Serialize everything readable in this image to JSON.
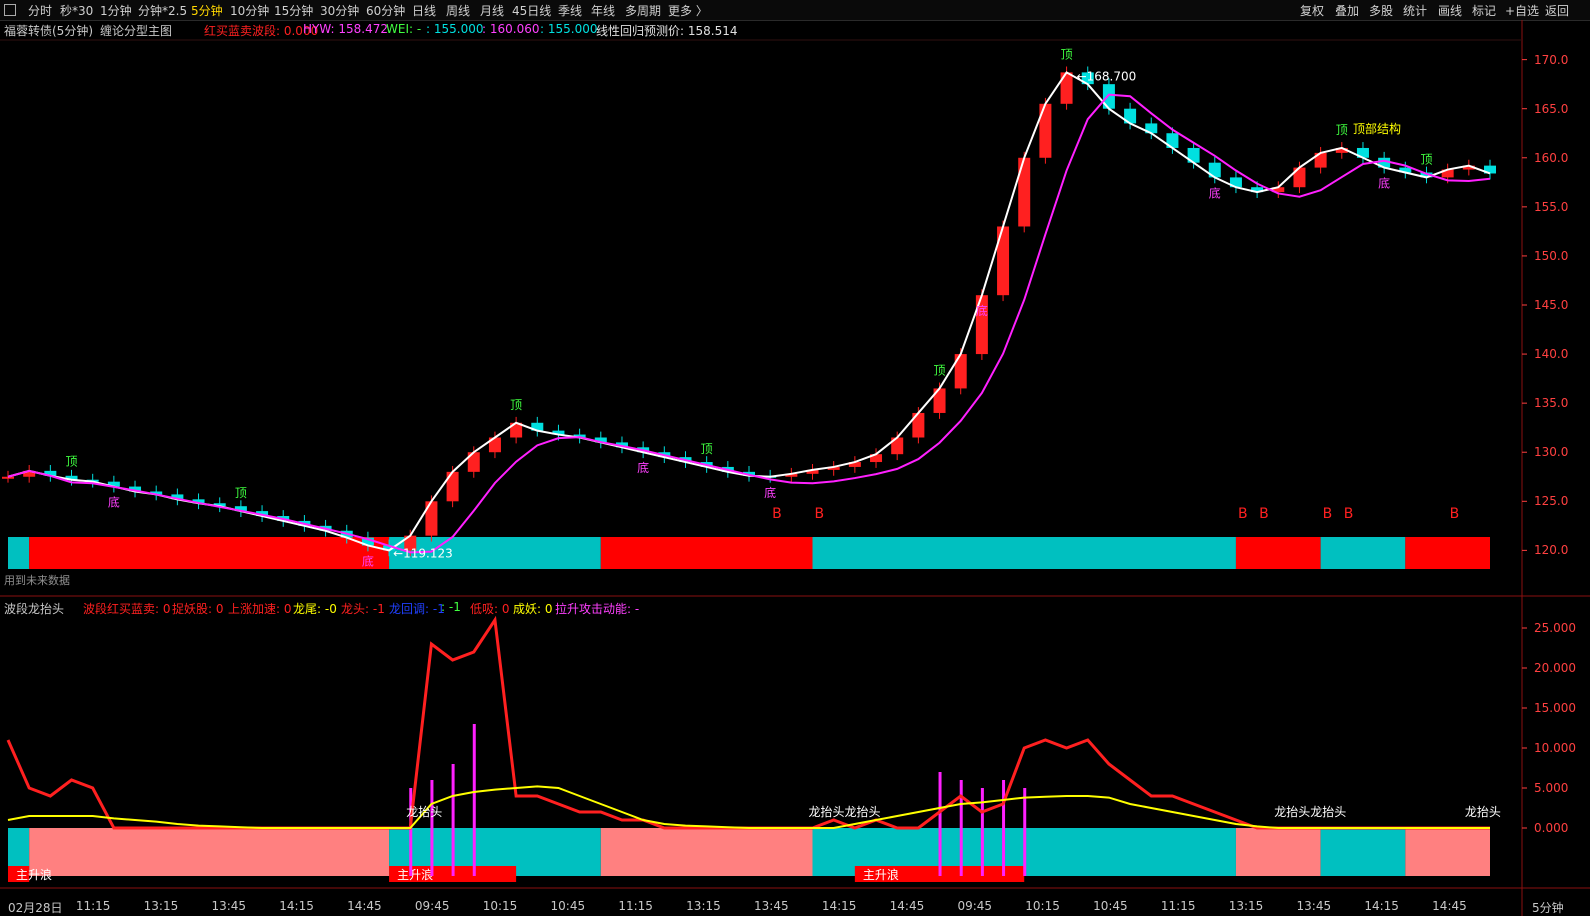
{
  "toolbar": {
    "periods": [
      "分时",
      "秒*30",
      "1分钟",
      "分钟*2.5",
      "5分钟",
      "10分钟",
      "15分钟",
      "30分钟",
      "60分钟",
      "日线",
      "周线",
      "月线",
      "45日线",
      "季线",
      "年线",
      "多周期",
      "更多 〉"
    ],
    "active_period": "5分钟",
    "right_actions": [
      "复权",
      "叠加",
      "多股",
      "统计",
      "画线",
      "标记",
      "+自选",
      "返回"
    ]
  },
  "main_panel": {
    "security": "福蓉转债(5分钟)",
    "indicator_name": "缠论分型主图",
    "items": [
      {
        "label": "红买蓝卖波段: 0.000",
        "color": "#ff2020"
      },
      {
        "label": "HYW: 158.472",
        "color": "#ff40ff"
      },
      {
        "label": "WEI: -",
        "color": "#40ff40"
      },
      {
        "label": ": 155.000",
        "color": "#00e0e0"
      },
      {
        "label": ": 160.060",
        "color": "#ff40ff"
      },
      {
        "label": ": 155.000",
        "color": "#00e0e0"
      },
      {
        "label": "线性回归预测价: 158.514",
        "color": "#e0e0e0"
      }
    ],
    "future_note": "用到未来数据",
    "price_high_label": "168.700",
    "price_low_label": "119.123",
    "pattern_label": "顶部结构"
  },
  "sub_panel": {
    "indicator_name": "波段龙抬头",
    "items": [
      {
        "label": "波段红买蓝卖: 0",
        "color": "#ff2020"
      },
      {
        "label": "捉妖股: 0",
        "color": "#ff2020"
      },
      {
        "label": "上涨加速: 0",
        "color": "#ff2020"
      },
      {
        "label": "龙尾: -0",
        "color": "#ffff00"
      },
      {
        "label": "龙头: -1",
        "color": "#ff2020"
      },
      {
        "label": "龙回调: -1",
        "color": "#2040ff"
      },
      {
        "label": ": -1",
        "color": "#40ff40"
      },
      {
        "label": "低吸: 0",
        "color": "#ff2020"
      },
      {
        "label": "成妖: 0",
        "color": "#ffff00"
      },
      {
        "label": "拉升攻击动能: -",
        "color": "#ff40ff"
      }
    ],
    "zhushenglang_labels": [
      "主升浪",
      "主升浪",
      "主升浪"
    ],
    "longtaitou_labels": [
      "龙抬头",
      "龙抬头龙抬头",
      "龙抬头龙抬头",
      "龙抬头"
    ]
  },
  "colors": {
    "up": "#ff2020",
    "down": "#00e0e0",
    "axis": "#ff4040",
    "bg": "#000000"
  },
  "chart_data": [
    {
      "type": "candlestick",
      "title": "福蓉转债(5分钟)",
      "ylim": [
        118,
        172
      ],
      "y_ticks": [
        120,
        125,
        130,
        135,
        140,
        145,
        150,
        155,
        160,
        165,
        170
      ],
      "y_tick_labels": [
        "120.0",
        "125.0",
        "130.0",
        "135.0",
        "140.0",
        "145.0",
        "150.0",
        "155.0",
        "160.0",
        "165.0",
        "170.0"
      ],
      "x_ticks": [
        "02月28日",
        "11:15",
        "13:15",
        "13:45",
        "14:15",
        "14:45",
        "09:45",
        "10:15",
        "10:45",
        "11:15",
        "13:15",
        "13:45",
        "14:15",
        "14:45",
        "09:45",
        "10:15",
        "10:45",
        "11:15",
        "13:15",
        "13:45",
        "14:15",
        "14:45"
      ],
      "grid": false,
      "segments": [
        {
          "name": "day1",
          "start": 127.5,
          "end": 120.0
        },
        {
          "name": "day2",
          "start": 121.0,
          "end": 128.0
        },
        {
          "name": "day3",
          "start": 128.0,
          "end": 168.7
        },
        {
          "name": "day4",
          "start": 168.7,
          "end": 158.4
        }
      ],
      "markers": {
        "top": "顶",
        "bottom": "底",
        "buy": "B"
      },
      "close_trace": [
        127.5,
        128.1,
        127.6,
        127.2,
        127.0,
        126.5,
        126.0,
        125.7,
        125.2,
        124.8,
        124.5,
        124.0,
        123.5,
        123.0,
        122.5,
        122.0,
        121.3,
        120.5,
        120.0,
        121.5,
        125.0,
        128.0,
        130.0,
        131.5,
        133.0,
        132.2,
        131.8,
        131.5,
        131.0,
        130.5,
        130.0,
        129.5,
        129.0,
        128.5,
        128.0,
        127.6,
        127.5,
        127.8,
        128.2,
        128.5,
        129.0,
        129.8,
        131.5,
        134.0,
        136.5,
        140.0,
        146.0,
        153.0,
        160.0,
        165.5,
        168.7,
        167.5,
        165.0,
        163.5,
        162.5,
        161.0,
        159.5,
        158.0,
        157.0,
        156.5,
        157.0,
        159.0,
        160.5,
        161.0,
        160.0,
        159.0,
        158.5,
        158.0,
        158.8,
        159.2,
        158.4
      ]
    },
    {
      "type": "line",
      "title": "波段龙抬头",
      "ylim": [
        -7,
        27
      ],
      "y_ticks": [
        0,
        5,
        10,
        15,
        20,
        25
      ],
      "y_tick_labels": [
        "0.000",
        "5.000",
        "10.000",
        "15.000",
        "20.000",
        "25.000"
      ],
      "series": [
        {
          "name": "龙头",
          "values": [
            11,
            5,
            4,
            6,
            5,
            0,
            0,
            0,
            0,
            0,
            0,
            0,
            0,
            0,
            0,
            0,
            0,
            0,
            0,
            0,
            23,
            21,
            22,
            26,
            4,
            4,
            3,
            2,
            2,
            1,
            1,
            0,
            0,
            0,
            0,
            0,
            0,
            0,
            0,
            1,
            0,
            1,
            0,
            0,
            2,
            4,
            2,
            3,
            10,
            11,
            10,
            11,
            8,
            6,
            4,
            4,
            3,
            2,
            1,
            0,
            0,
            0,
            0,
            0,
            0,
            0,
            0,
            0,
            0,
            0,
            0
          ]
        },
        {
          "name": "龙尾",
          "values": [
            1,
            1.5,
            1.5,
            1.5,
            1.5,
            1.2,
            1,
            0.8,
            0.5,
            0.3,
            0.2,
            0.1,
            0,
            0,
            0,
            0,
            0,
            0,
            0,
            0,
            3,
            4,
            4.5,
            4.8,
            5,
            5.2,
            5,
            4,
            3,
            2,
            1,
            0.5,
            0.3,
            0.2,
            0.1,
            0,
            0,
            0,
            0,
            0,
            0.5,
            1,
            1.5,
            2,
            2.5,
            3,
            3.2,
            3.5,
            3.8,
            3.9,
            4,
            4,
            3.8,
            3,
            2.5,
            2,
            1.5,
            1,
            0.5,
            0.2,
            0,
            0,
            0,
            0,
            0,
            0,
            0,
            0,
            0,
            0,
            0
          ]
        }
      ]
    }
  ]
}
